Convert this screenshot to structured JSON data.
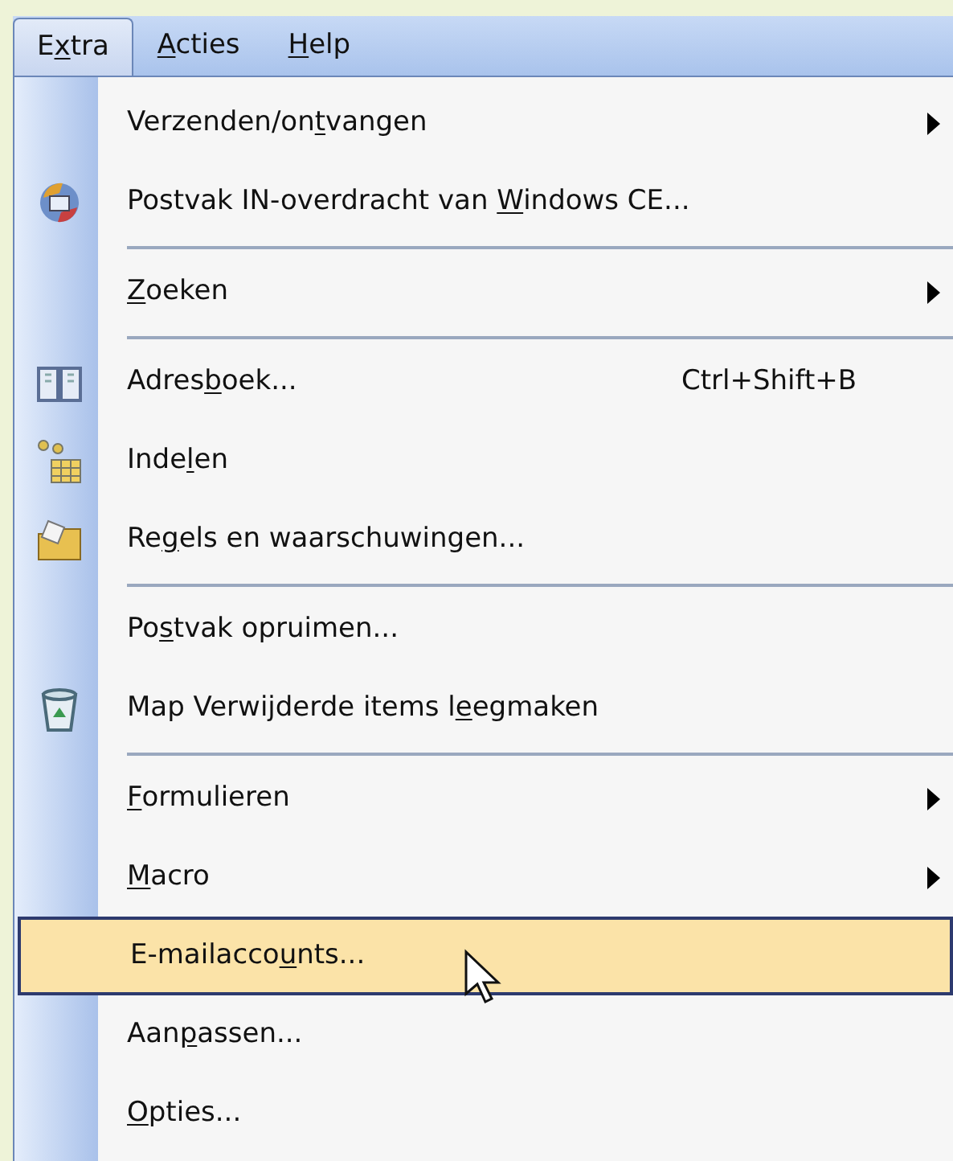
{
  "menubar": [
    {
      "label": {
        "pre": "E",
        "key": "x",
        "post": "tra"
      },
      "selected": true
    },
    {
      "label": {
        "key": "A",
        "post": "cties"
      },
      "selected": false
    },
    {
      "label": {
        "key": "H",
        "post": "elp"
      },
      "selected": false
    }
  ],
  "menu": {
    "items": [
      {
        "kind": "item",
        "label": {
          "pre": "Verzenden/on",
          "key": "t",
          "post": "vangen"
        },
        "submenu": true,
        "has_icon": false,
        "selected": false
      },
      {
        "kind": "item",
        "label": {
          "pre": "Postvak IN-overdracht van ",
          "key": "W",
          "post": "indows CE..."
        },
        "submenu": false,
        "has_icon": true,
        "selected": false
      },
      {
        "kind": "separator"
      },
      {
        "kind": "item",
        "label": {
          "key": "Z",
          "post": "oeken"
        },
        "submenu": true,
        "has_icon": false,
        "selected": false
      },
      {
        "kind": "separator"
      },
      {
        "kind": "item",
        "label": {
          "pre": "Adres",
          "key": "b",
          "post": "oek..."
        },
        "shortcut": "Ctrl+Shift+B",
        "submenu": false,
        "has_icon": true,
        "selected": false
      },
      {
        "kind": "item",
        "label": {
          "pre": "Inde",
          "key": "l",
          "post": "en"
        },
        "submenu": false,
        "has_icon": true,
        "selected": false
      },
      {
        "kind": "item",
        "label": {
          "pre": "Re",
          "key": "g",
          "post": "els en waarschuwingen..."
        },
        "submenu": false,
        "has_icon": true,
        "selected": false
      },
      {
        "kind": "separator"
      },
      {
        "kind": "item",
        "label": {
          "pre": "Po",
          "key": "s",
          "post": "tvak opruimen..."
        },
        "submenu": false,
        "has_icon": false,
        "selected": false
      },
      {
        "kind": "item",
        "label": {
          "pre": "Map Verwijderde items l",
          "key": "e",
          "post": "egmaken"
        },
        "submenu": false,
        "has_icon": true,
        "selected": false
      },
      {
        "kind": "separator"
      },
      {
        "kind": "item",
        "label": {
          "key": "F",
          "post": "ormulieren"
        },
        "submenu": true,
        "has_icon": false,
        "selected": false
      },
      {
        "kind": "item",
        "label": {
          "key": "M",
          "post": "acro"
        },
        "submenu": true,
        "has_icon": false,
        "selected": false
      },
      {
        "kind": "item",
        "label": {
          "pre": "E-mailacco",
          "key": "u",
          "post": "nts..."
        },
        "submenu": false,
        "has_icon": false,
        "selected": true
      },
      {
        "kind": "item",
        "label": {
          "pre": "Aan",
          "key": "p",
          "post": "assen..."
        },
        "submenu": false,
        "has_icon": false,
        "selected": false
      },
      {
        "kind": "item",
        "label": {
          "key": "O",
          "post": "pties..."
        },
        "submenu": false,
        "has_icon": false,
        "selected": false
      }
    ]
  }
}
